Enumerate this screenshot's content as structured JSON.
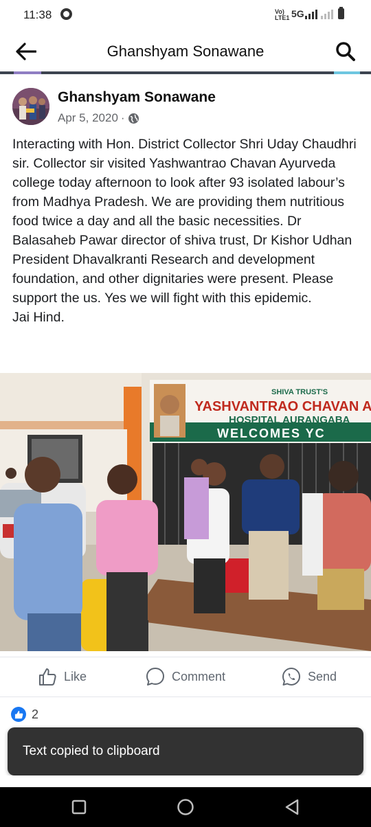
{
  "status_bar": {
    "time": "11:38",
    "volte_label": "Vo) LTE1",
    "network_label": "5G"
  },
  "header": {
    "title": "Ghanshyam Sonawane",
    "back_icon": "back-arrow-icon",
    "search_icon": "search-icon"
  },
  "post": {
    "author": "Ghanshyam Sonawane",
    "date": "Apr 5, 2020",
    "separator": "·",
    "privacy_icon": "globe-icon",
    "text": "Interacting with Hon. District Collector Shri Uday Chaudhri sir. Collector sir visited Yashwantrao Chavan Ayurveda college today afternoon to look after 93 isolated labour’s from Madhya Pradesh. We are providing them nutritious food twice a day and all the basic necessities. Dr Balasaheb Pawar director of shiva trust, Dr Kishor Udhan President Dhavalkranti Research and development foundation, and other dignitaries were present. Please support the us. Yes we will fight with this epidemic.\nJai Hind.",
    "photo": {
      "banner_line1": "SHIVA TRUST'S",
      "banner_line2": "YASHVANTRAO CHAVAN A",
      "banner_line3": "HOSPITAL AURANGABA",
      "banner_line4": "WELCOMES YC"
    }
  },
  "actions": {
    "like_label": "Like",
    "comment_label": "Comment",
    "send_label": "Send"
  },
  "reactions": {
    "count": "2"
  },
  "toast": {
    "message": "Text copied to clipboard"
  },
  "colors": {
    "like_blue": "#1877f2",
    "toast_bg": "#323232",
    "header_rule": "#3d4450"
  }
}
